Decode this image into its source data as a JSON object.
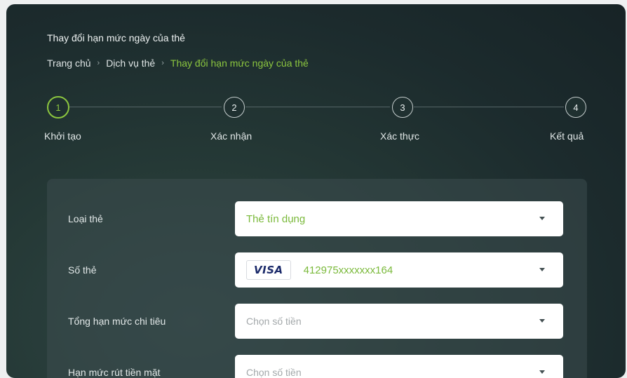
{
  "header": {
    "title": "Thay đổi hạn mức ngày của thẻ"
  },
  "breadcrumb": {
    "items": [
      {
        "label": "Trang chủ"
      },
      {
        "label": "Dịch vụ thẻ"
      },
      {
        "label": "Thay đổi hạn mức ngày của thẻ"
      }
    ],
    "separator": "›"
  },
  "stepper": {
    "active_step": 1,
    "steps": [
      {
        "number": "1",
        "label": "Khởi tạo"
      },
      {
        "number": "2",
        "label": "Xác nhận"
      },
      {
        "number": "3",
        "label": "Xác thực"
      },
      {
        "number": "4",
        "label": "Kết quả"
      }
    ]
  },
  "form": {
    "card_type": {
      "label": "Loại thẻ",
      "value": "Thẻ tín dụng"
    },
    "card_number": {
      "label": "Số thẻ",
      "brand": "VISA",
      "value": "412975xxxxxxx164"
    },
    "total_spending_limit": {
      "label": "Tổng hạn mức chi tiêu",
      "placeholder": "Chọn số tiền"
    },
    "cash_withdrawal_limit": {
      "label": "Hạn mức rút tiền mặt",
      "placeholder": "Chọn số tiền"
    }
  },
  "colors": {
    "accent": "#8cc63f",
    "background": "#1c2b2d",
    "panel": "#3c4c4e"
  }
}
